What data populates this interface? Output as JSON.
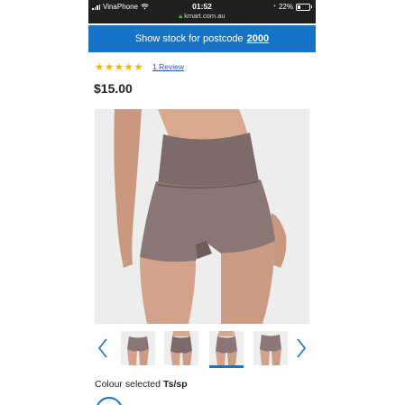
{
  "status_bar": {
    "carrier": "VinaPhone",
    "time": "01:52",
    "url": "kmart.com.au",
    "battery_text": "22%",
    "battery_level": 0.22
  },
  "stock_bar": {
    "label": "Show stock for postcode",
    "postcode": "2000"
  },
  "rating": {
    "stars": "★★★★★",
    "value": 5,
    "review_link": "1 Review"
  },
  "price": "$15.00",
  "product_image": {
    "icon": "shorts-photo"
  },
  "gallery": {
    "prev_icon": "chevron-left-icon",
    "next_icon": "chevron-right-icon",
    "thumbnail_count": 4,
    "selected_index": 2
  },
  "colour": {
    "label": "Colour selected",
    "value": "Ts/sp"
  },
  "colors": {
    "accent": "#1673c6",
    "star": "#f6b500",
    "garment": "#8a7676",
    "status_bar": "#1f1f1f"
  }
}
